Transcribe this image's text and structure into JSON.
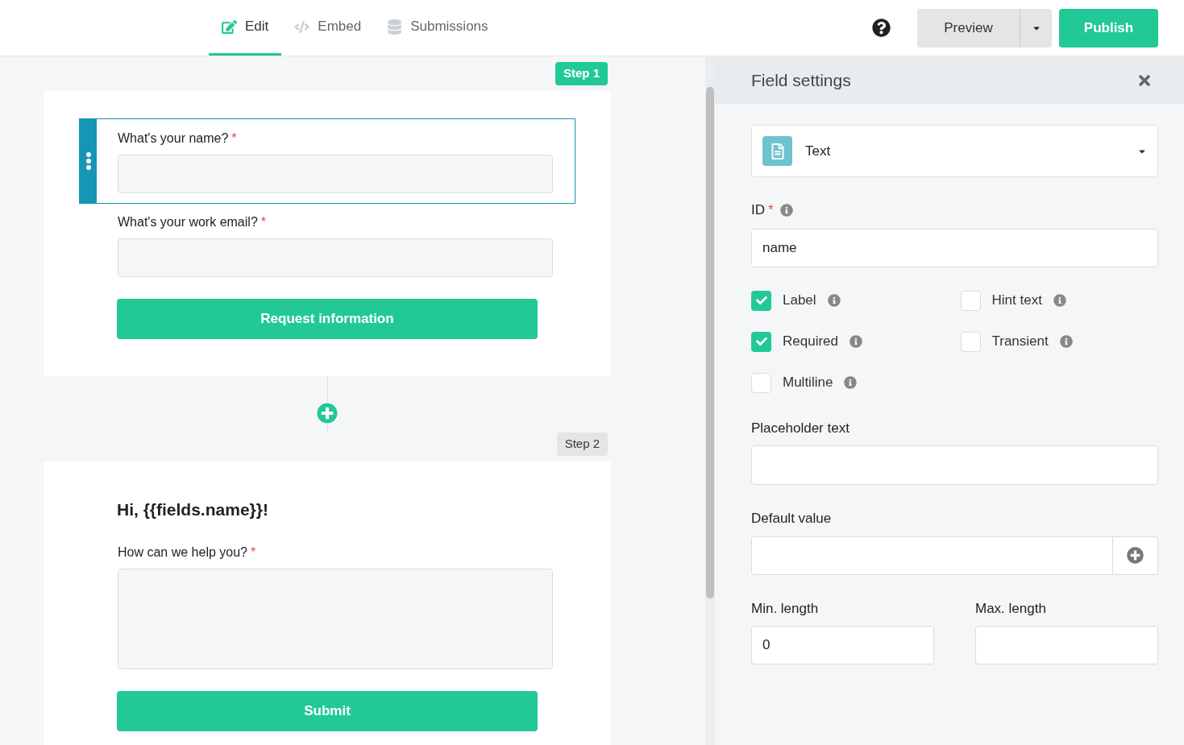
{
  "tabs": [
    {
      "label": "Edit",
      "selected": true
    },
    {
      "label": "Embed",
      "selected": false
    },
    {
      "label": "Submissions",
      "selected": false
    }
  ],
  "header": {
    "preview": "Preview",
    "publish": "Publish"
  },
  "steps": [
    {
      "badge": "Step 1",
      "selected": true,
      "items": [
        {
          "kind": "input",
          "label": "What's your name?",
          "required_mark": "*",
          "selected": true
        },
        {
          "kind": "input",
          "label": "What's your work email?",
          "required_mark": "*",
          "selected": false
        },
        {
          "kind": "button",
          "label": "Request information"
        }
      ]
    },
    {
      "badge": "Step 2",
      "selected": false,
      "items": [
        {
          "kind": "heading",
          "label": "Hi, {{fields.name}}!"
        },
        {
          "kind": "textarea",
          "label": "How can we help you?",
          "required_mark": "*",
          "selected": false
        },
        {
          "kind": "button",
          "label": "Submit"
        }
      ]
    }
  ],
  "settings": {
    "title": "Field settings",
    "type": "Text",
    "id": {
      "label": "ID",
      "required_mark": "*",
      "value": "name"
    },
    "options": [
      {
        "label": "Label",
        "checked": true
      },
      {
        "label": "Hint text",
        "checked": false
      },
      {
        "label": "Required",
        "checked": true
      },
      {
        "label": "Transient",
        "checked": false
      },
      {
        "label": "Multiline",
        "checked": false
      }
    ],
    "placeholder_label": "Placeholder text",
    "default_label": "Default value",
    "min": {
      "label": "Min. length",
      "value": "0"
    },
    "max": {
      "label": "Max. length"
    }
  }
}
